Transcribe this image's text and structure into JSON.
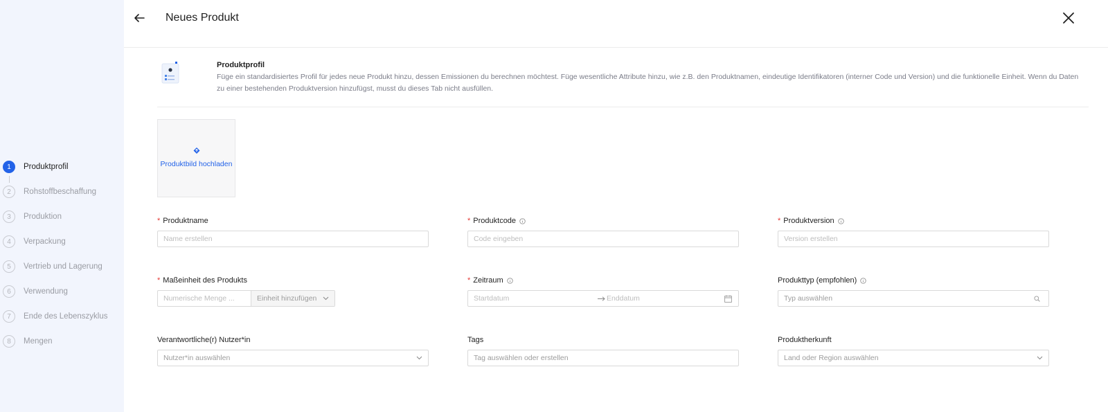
{
  "header": {
    "title": "Neues Produkt"
  },
  "sidebar": {
    "steps": [
      {
        "num": "1",
        "label": "Produktprofil",
        "active": true
      },
      {
        "num": "2",
        "label": "Rohstoffbeschaffung"
      },
      {
        "num": "3",
        "label": "Produktion"
      },
      {
        "num": "4",
        "label": "Verpackung"
      },
      {
        "num": "5",
        "label": "Vertrieb und Lagerung"
      },
      {
        "num": "6",
        "label": "Verwendung"
      },
      {
        "num": "7",
        "label": "Ende des Lebenszyklus"
      },
      {
        "num": "8",
        "label": "Mengen"
      }
    ]
  },
  "intro": {
    "title": "Produktprofil",
    "description": "Füge ein standardisiertes Profil für jedes neue Produkt hinzu, dessen Emissionen du berechnen möchtest. Füge wesentliche Attribute hinzu, wie z.B. den Produktnamen, eindeutige Identifikatoren (interner Code und Version) und die funktionelle Einheit. Wenn du Daten zu einer bestehenden Produktversion hinzufügst, musst du dieses Tab nicht ausfüllen."
  },
  "upload": {
    "label": "Produktbild hochladen"
  },
  "form": {
    "product_name": {
      "label": "Produktname",
      "placeholder": "Name erstellen"
    },
    "product_code": {
      "label": "Produktcode",
      "placeholder": "Code eingeben"
    },
    "product_version": {
      "label": "Produktversion",
      "placeholder": "Version erstellen"
    },
    "unit": {
      "label": "Maßeinheit des Produkts",
      "quantity_placeholder": "Numerische Menge ...",
      "unit_placeholder": "Einheit hinzufügen"
    },
    "period": {
      "label": "Zeitraum",
      "start_placeholder": "Startdatum",
      "end_placeholder": "Enddatum"
    },
    "product_type": {
      "label": "Produkttyp (empfohlen)",
      "placeholder": "Typ auswählen"
    },
    "responsible_user": {
      "label": "Verantwortliche(r) Nutzer*in",
      "placeholder": "Nutzer*in auswählen"
    },
    "tags": {
      "label": "Tags",
      "placeholder": "Tag auswählen oder erstellen"
    },
    "origin": {
      "label": "Produktherkunft",
      "placeholder": "Land oder Region auswählen"
    }
  },
  "colors": {
    "accent": "#2262e8",
    "sidebar_bg": "#f2f5fd",
    "required": "#e53935",
    "muted_text": "#7a7c88"
  },
  "icons": [
    "back-arrow-icon",
    "close-icon",
    "document-illustration",
    "upload-icon",
    "info-icon",
    "chevron-down-icon",
    "search-icon",
    "calendar-icon",
    "arrow-right-icon"
  ]
}
